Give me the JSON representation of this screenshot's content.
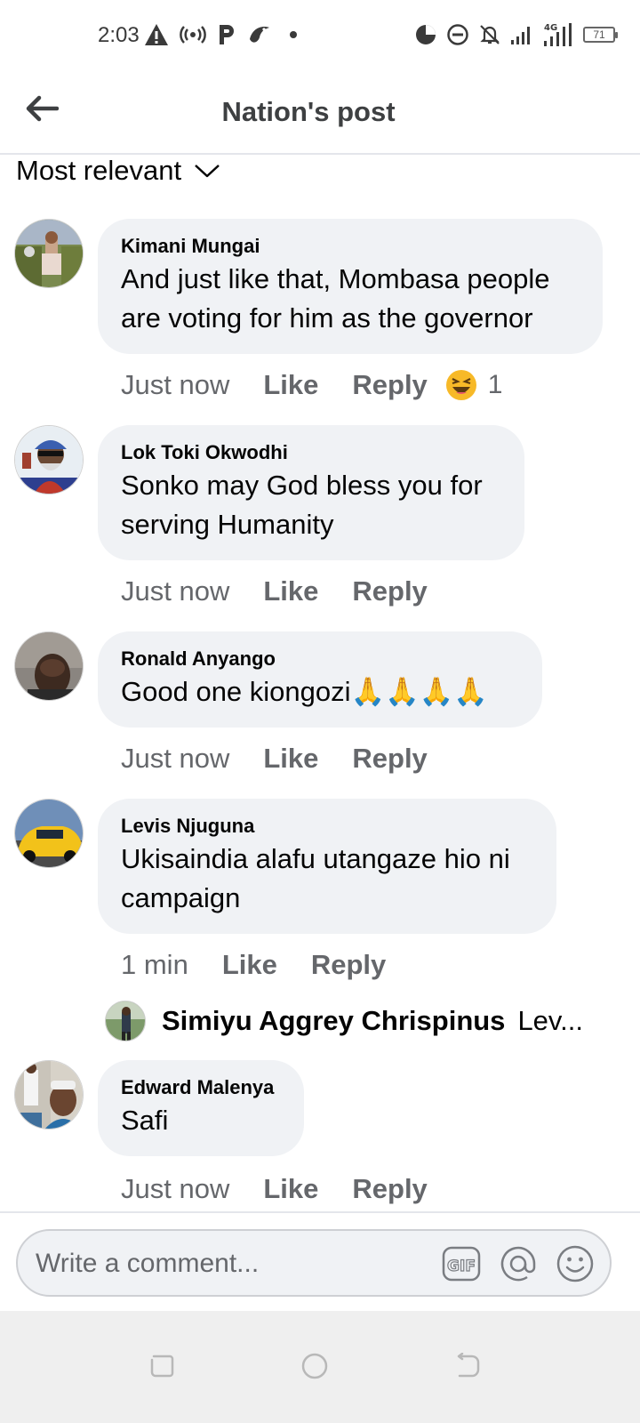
{
  "status_bar": {
    "time": "2:03",
    "network_label": "4G",
    "battery": "71"
  },
  "header": {
    "title": "Nation's post"
  },
  "sort": {
    "label": "Most relevant"
  },
  "comments": [
    {
      "author": "Kimani Mungai",
      "text": "And just like that, Mombasa people are voting for him as the governor",
      "time": "Just now",
      "like": "Like",
      "reply": "Reply",
      "reaction_emoji": "😆",
      "reaction_count": "1"
    },
    {
      "author": "Lok Toki Okwodhi",
      "text": "Sonko may God bless you for serving Humanity",
      "time": "Just now",
      "like": "Like",
      "reply": "Reply"
    },
    {
      "author": "Ronald Anyango",
      "text": "Good one kiongozi🙏🙏🙏🙏",
      "time": "Just now",
      "like": "Like",
      "reply": "Reply"
    },
    {
      "author": "Levis Njuguna",
      "text": "Ukisaindia alafu utangaze hio ni campaign",
      "time": "1 min",
      "like": "Like",
      "reply": "Reply",
      "reply_preview": {
        "author": "Simiyu Aggrey Chrispinus",
        "snippet": "Lev..."
      }
    },
    {
      "author": "Edward Malenya",
      "text": "Safi",
      "time": "Just now",
      "like": "Like",
      "reply": "Reply"
    }
  ],
  "composer": {
    "placeholder": "Write a comment...",
    "gif_label": "GIF"
  },
  "colors": {
    "bubble": "#f0f2f5",
    "meta_text": "#65676b",
    "title_text": "#3e4042"
  }
}
